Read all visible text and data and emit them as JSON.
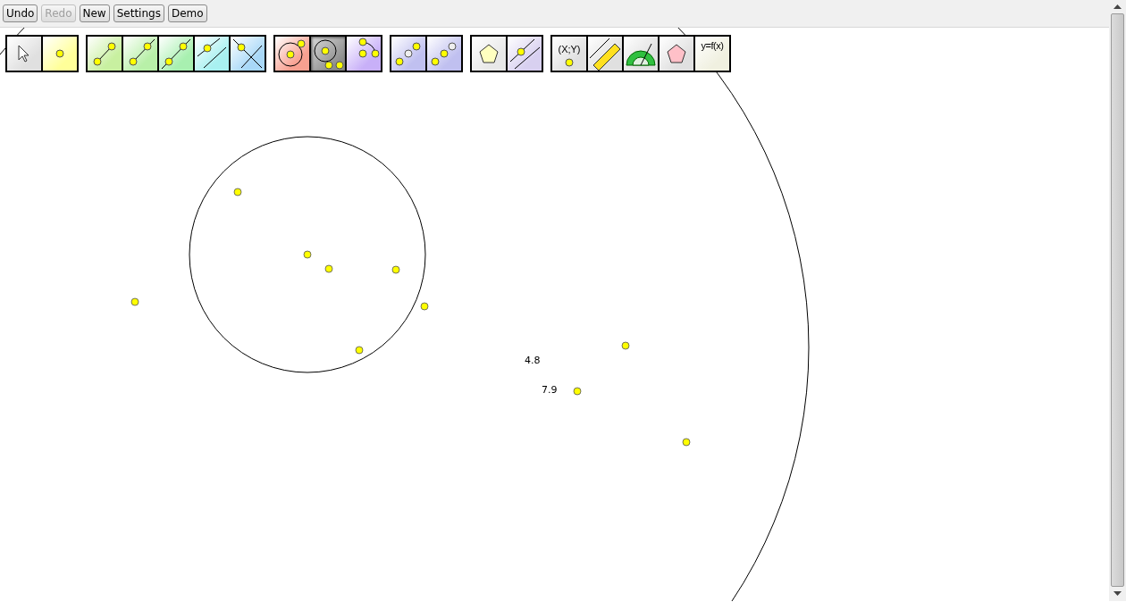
{
  "menu_buttons": [
    {
      "label": "Undo",
      "disabled": false
    },
    {
      "label": "Redo",
      "disabled": true
    },
    {
      "label": "New",
      "disabled": false
    },
    {
      "label": "Settings",
      "disabled": false
    },
    {
      "label": "Demo",
      "disabled": false
    }
  ],
  "tool_groups": [
    [
      {
        "kind": "pointer",
        "selected": false
      },
      {
        "kind": "point",
        "selected": false
      }
    ],
    [
      {
        "kind": "segment",
        "selected": false
      },
      {
        "kind": "ray",
        "selected": false
      },
      {
        "kind": "line",
        "selected": false
      },
      {
        "kind": "parallel",
        "selected": false
      },
      {
        "kind": "perpendicular",
        "selected": false
      }
    ],
    [
      {
        "kind": "circle",
        "selected": false
      },
      {
        "kind": "circle-radius",
        "selected": true
      },
      {
        "kind": "arc",
        "selected": false
      }
    ],
    [
      {
        "kind": "midpoint",
        "selected": false
      },
      {
        "kind": "reflect",
        "selected": false
      }
    ],
    [
      {
        "kind": "polygon",
        "selected": false
      },
      {
        "kind": "point-on-line",
        "selected": false
      }
    ],
    [
      {
        "kind": "coordinates",
        "label": "(X;Y)",
        "selected": false
      },
      {
        "kind": "ruler",
        "selected": false
      },
      {
        "kind": "protractor",
        "selected": false
      },
      {
        "kind": "regular-polygon",
        "selected": false
      },
      {
        "kind": "function",
        "label": "y=f(x)",
        "selected": false
      }
    ]
  ],
  "canvas_labels": [
    "4.8",
    "7.9"
  ]
}
